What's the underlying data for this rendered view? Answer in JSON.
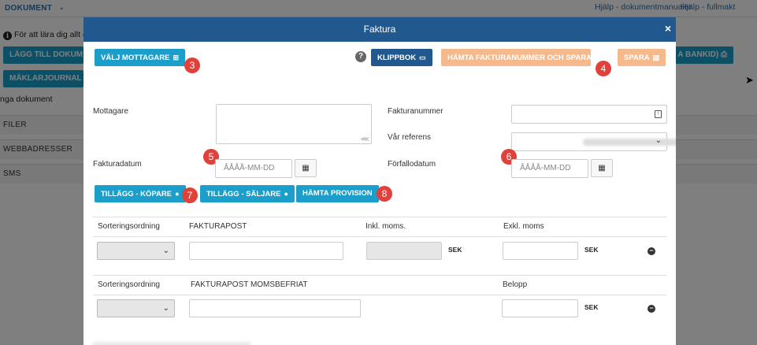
{
  "background": {
    "nav_label": "DOKUMENT",
    "help_docs": "Hjälp - dokumentmanualer",
    "help_fullmakt": "Hjälp - fullmakt",
    "info_text": "För att lära dig allt o",
    "add_button": "LÄGG TILL DOKUM",
    "journal_button": "MÄKLARJOURNAL",
    "bankid_button": "A BANKID)",
    "sign_label": "nga dokument",
    "rows": [
      "FILER",
      "WEBBADRESSER",
      "SMS"
    ]
  },
  "modal": {
    "title": "Faktura",
    "close": "×",
    "buttons": {
      "choose_recipient": "VÄLJ MOTTAGARE",
      "clipboard": "KLIPPBOK",
      "fetch_number_save": "HÄMTA FAKTURANUMMER OCH SPARA",
      "save": "SPARA",
      "addon_buyer": "TILLÄGG - KÖPARE",
      "addon_seller": "TILLÄGG - SÄLJARE",
      "fetch_commission": "HÄMTA PROVISION"
    },
    "badges": [
      "3",
      "4",
      "5",
      "6",
      "7",
      "8"
    ],
    "help_glyph": "?",
    "fields": {
      "recipient_label": "Mottagare",
      "invoice_number_label": "Fakturanummer",
      "our_reference_label": "Vår referens",
      "invoice_date_label": "Fakturadatum",
      "invoice_date_placeholder": "ÅÅÅÅ-MM-DD",
      "due_date_label": "Förfallodatum",
      "due_date_placeholder": "ÅÅÅÅ-MM-DD"
    },
    "table1": {
      "headers": [
        "Sorteringsordning",
        "FAKTURAPOST",
        "Inkl. moms.",
        "Exkl. moms"
      ],
      "currency1": "SEK",
      "currency2": "SEK"
    },
    "table2": {
      "headers": [
        "Sorteringsordning",
        "FAKTURAPOST MOMSBEFRIAT",
        "Belopp"
      ],
      "currency": "SEK"
    }
  },
  "colors": {
    "header": "#21598f",
    "teal": "#1b9ec9",
    "peach": "#f5b98c",
    "badge": "#e0413a"
  }
}
